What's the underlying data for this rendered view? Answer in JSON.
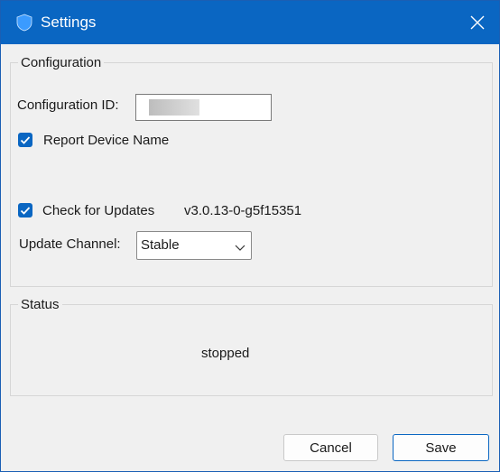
{
  "window": {
    "title": "Settings",
    "accent": "#0a66c2"
  },
  "configuration": {
    "legend": "Configuration",
    "config_id_label": "Configuration ID:",
    "report_device_name": {
      "label": "Report Device Name",
      "checked": true
    },
    "check_updates": {
      "label": "Check for Updates",
      "checked": true
    },
    "version": "v3.0.13-0-g5f15351",
    "update_channel_label": "Update Channel:",
    "update_channel_value": "Stable"
  },
  "status": {
    "legend": "Status",
    "text": "stopped"
  },
  "buttons": {
    "cancel": "Cancel",
    "save": "Save"
  }
}
